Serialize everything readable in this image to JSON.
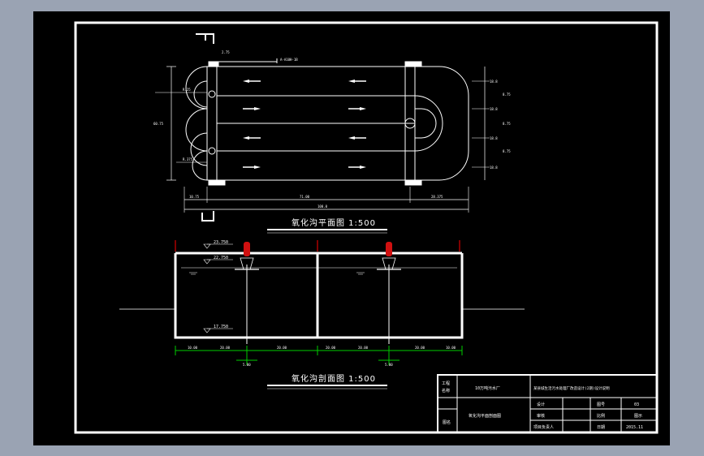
{
  "plan_view": {
    "title": "氧化沟平面图 1:500",
    "note_top": "2.75",
    "note_inlet": "A-A10H-1B",
    "right_dims": [
      "18.8",
      "18.8",
      "18.8",
      "18.8"
    ],
    "right_dims_b": [
      "8.75",
      "8.75",
      "8.75"
    ],
    "left_dims": [
      "R.25",
      "R.375",
      "60.75"
    ],
    "bottom_dims": [
      "10.75",
      "71.00",
      "28.375"
    ],
    "bottom_total": "100.0"
  },
  "section_view": {
    "title": "氧化沟剖面图 1:500",
    "levels": [
      "23.750",
      "22.750",
      "17.750"
    ],
    "bottom_dims": [
      "10.00",
      "20.00",
      "20.00",
      "20.00",
      "20.00",
      "20.00",
      "10.00"
    ],
    "sub_dims": [
      "5.00",
      "5.00"
    ]
  },
  "title_block": {
    "role_label_1": "工程",
    "role_label_2": "名称",
    "company": "10万吨污水厂",
    "project": "某县城生活污水处理厂改造设计(2期)设计说明",
    "drawing_label": "图名",
    "drawing_name": "氧化沟平面剖面图",
    "row1": [
      "设计",
      "图号",
      "03"
    ],
    "row2": [
      "审核",
      "比例",
      "图示"
    ],
    "row3": [
      "项目负责人",
      "日期",
      "2015.11"
    ]
  }
}
